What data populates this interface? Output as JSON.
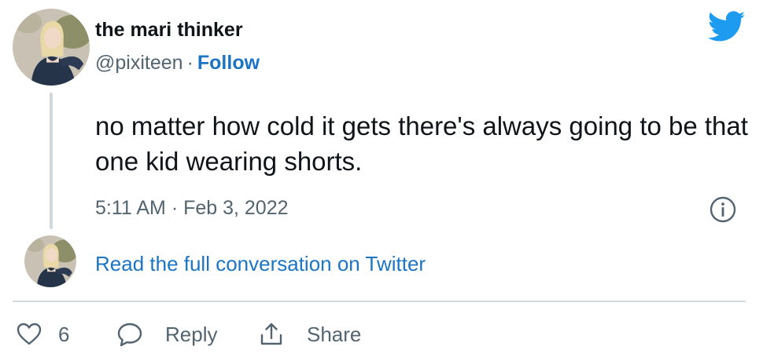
{
  "tweet": {
    "author_name": "the mari thinker",
    "handle": "@pixiteen",
    "separator": "·",
    "follow_label": "Follow",
    "text": "no matter how cold it gets there's always going to be that one kid wearing shorts.",
    "timestamp": "5:11 AM · Feb 3, 2022",
    "read_link": "Read the full conversation on Twitter"
  },
  "actions": {
    "like_count": "6",
    "reply_label": "Reply",
    "share_label": "Share"
  },
  "icons": {
    "brand": "twitter-bird",
    "info": "info",
    "like": "heart",
    "reply": "speech-bubble",
    "share": "share-upload"
  },
  "colors": {
    "twitter_blue": "#1d9bf0",
    "link_blue": "#1b74c4",
    "secondary_text": "#536471",
    "divider": "#cfd9de"
  }
}
